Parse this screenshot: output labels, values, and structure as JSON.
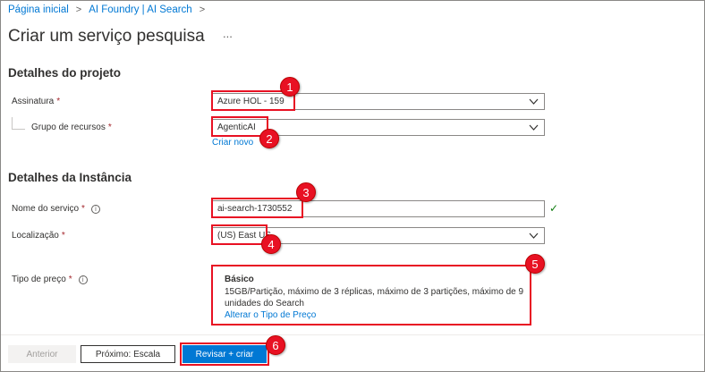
{
  "breadcrumb": [
    "Página inicial",
    "AI Foundry | AI Search"
  ],
  "page_title": "Criar um serviço pesquisa",
  "more_label": "...",
  "sections": {
    "project": "Detalhes do projeto",
    "instance": "Detalhes da Instância"
  },
  "fields": {
    "subscription": {
      "label": "Assinatura",
      "value": "Azure HOL - 159"
    },
    "resource_group": {
      "label": "Grupo de recursos",
      "value": "AgenticAI",
      "create_new": "Criar novo"
    },
    "service_name": {
      "label": "Nome do serviço",
      "value": "ai-search-1730552"
    },
    "location": {
      "label": "Localização",
      "value": "(US) East US"
    },
    "pricing": {
      "label": "Tipo de preço",
      "tier": "Básico",
      "description": "15GB/Partição, máximo de 3 réplicas, máximo de 3 partições, máximo de 9 unidades do Search",
      "change_link": "Alterar o Tipo de Preço"
    }
  },
  "required_mark": "*",
  "buttons": {
    "previous": "Anterior",
    "next": "Próximo: Escala",
    "review": "Revisar + criar"
  },
  "badges": [
    "1",
    "2",
    "3",
    "4",
    "5",
    "6"
  ],
  "colors": {
    "accent": "#0078d4",
    "highlight": "#e81123",
    "valid": "#107c10"
  },
  "icons": [
    "chevron-right-icon",
    "chevron-down-icon",
    "info-icon",
    "checkmark-icon"
  ]
}
